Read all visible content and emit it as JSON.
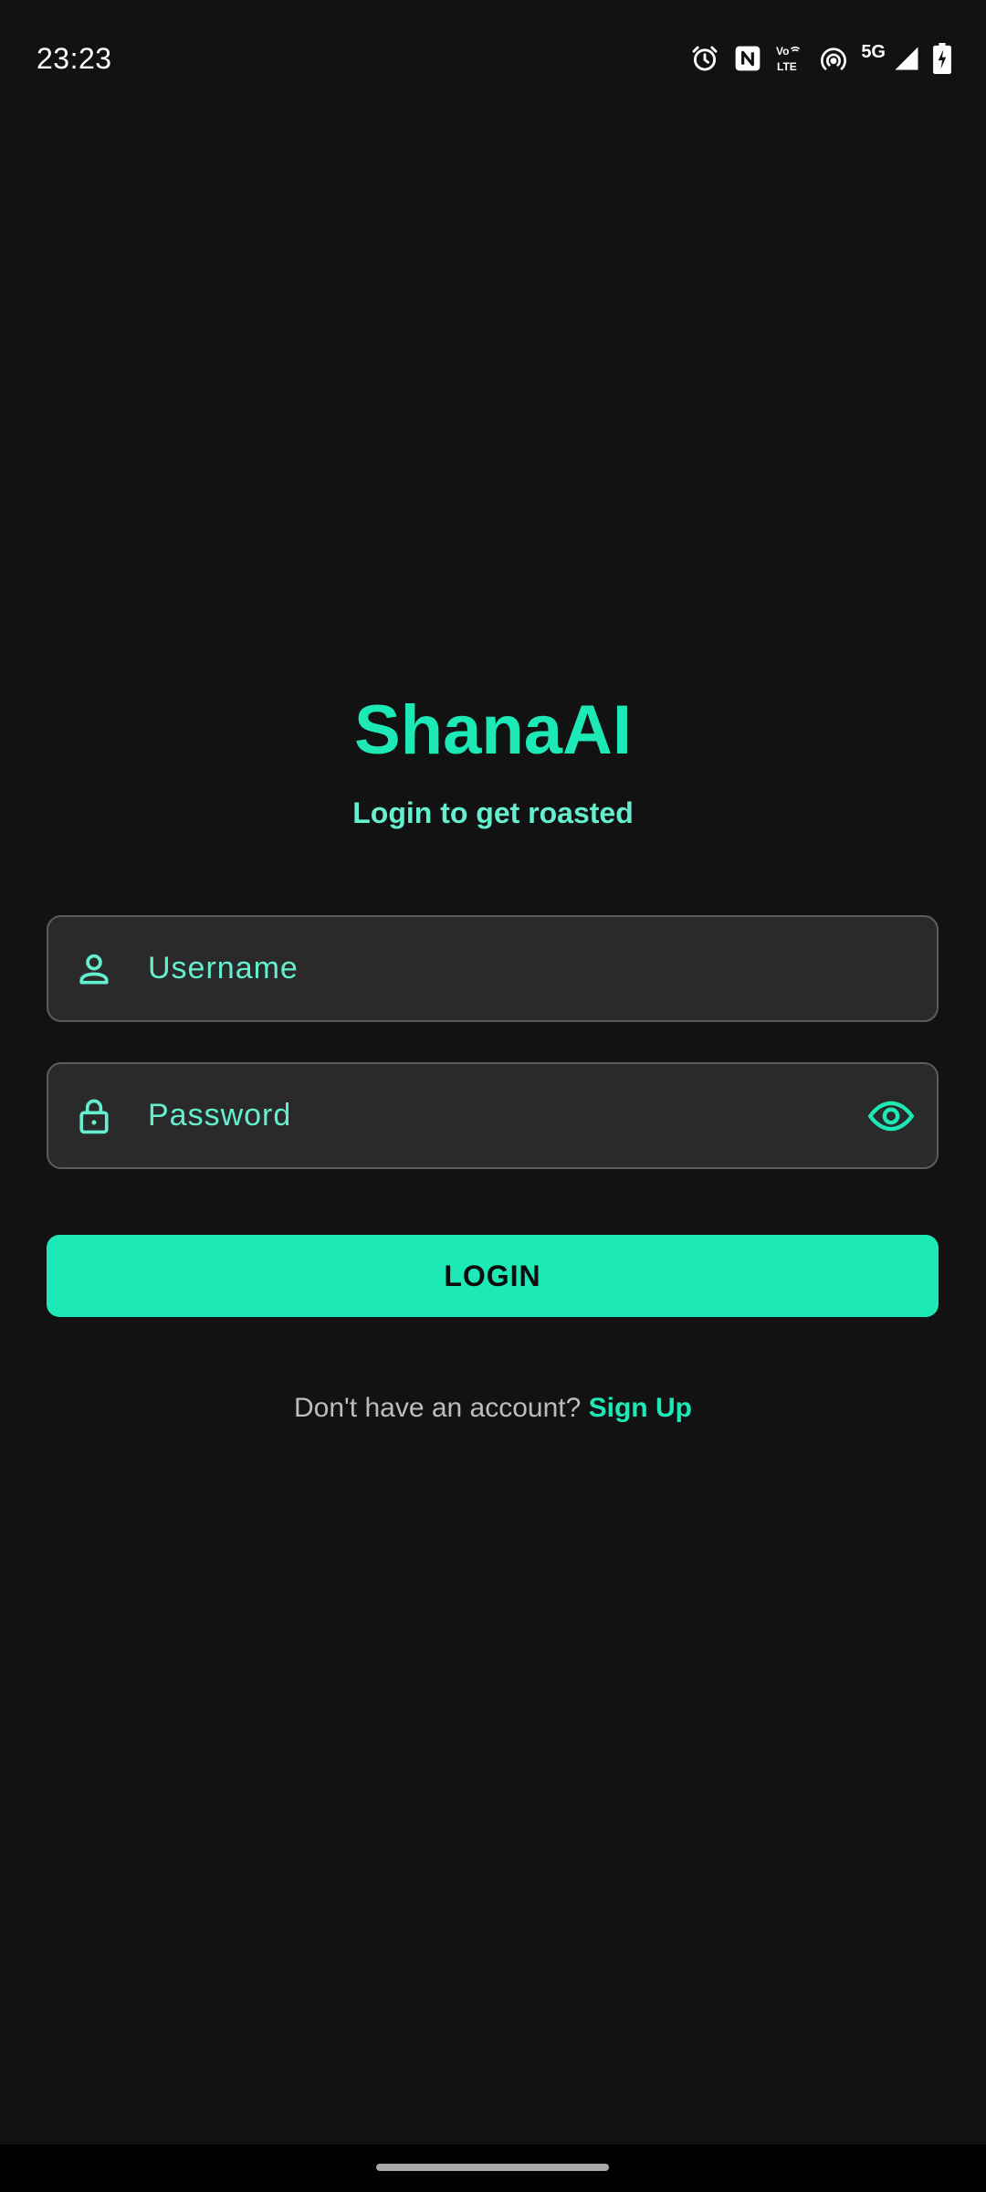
{
  "status_bar": {
    "time": "23:23",
    "network": "5G",
    "icons": [
      "alarm-icon",
      "nfc-icon",
      "volte-icon",
      "hotspot-icon",
      "signal-icon",
      "battery-charging-icon"
    ]
  },
  "header": {
    "title": "ShanaAI",
    "subtitle": "Login to get roasted"
  },
  "form": {
    "username": {
      "placeholder": "Username",
      "value": "",
      "icon": "person-icon"
    },
    "password": {
      "placeholder": "Password",
      "value": "",
      "icon": "lock-icon",
      "toggle_icon": "eye-icon"
    },
    "login_label": "LOGIN"
  },
  "signup": {
    "prompt": "Don't have an account?",
    "link_label": "Sign Up"
  },
  "colors": {
    "background": "#121212",
    "accent": "#1de9b6",
    "accent_light": "#64f0cf",
    "field_background": "#2a2a2a",
    "field_border": "#5c5c5c",
    "muted_text": "#bdbdbd"
  }
}
